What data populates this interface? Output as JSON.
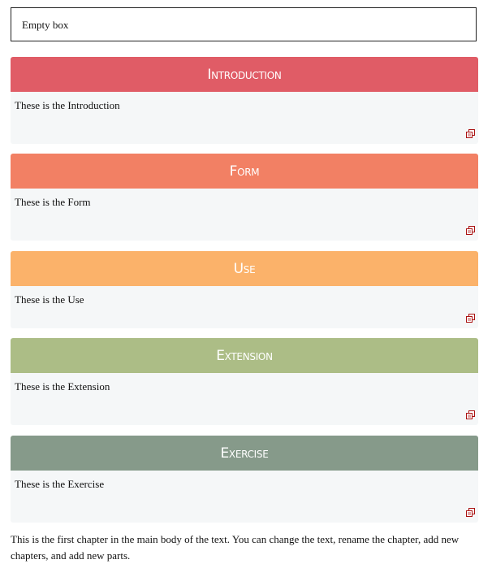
{
  "empty_box": {
    "text": "Empty box"
  },
  "sections": [
    {
      "title": "Introduction",
      "body": "These is the Introduction",
      "color": "#e05c66",
      "icon": "copy-icon"
    },
    {
      "title": "Form",
      "body": "These is the Form",
      "color": "#f28064",
      "icon": "copy-icon"
    },
    {
      "title": "Use",
      "body": "These is the Use",
      "color": "#fbb26a",
      "icon": "copy-icon"
    },
    {
      "title": "Extension",
      "body": "These is the Extension",
      "color": "#acbd86",
      "icon": "copy-icon"
    },
    {
      "title": "Exercise",
      "body": "These is the Exercise",
      "color": "#869a8a",
      "icon": "copy-icon"
    }
  ],
  "footer": {
    "text": "This is the first chapter in the main body of the text. You can change the text, rename the chapter, add new chapters, and add new parts."
  }
}
